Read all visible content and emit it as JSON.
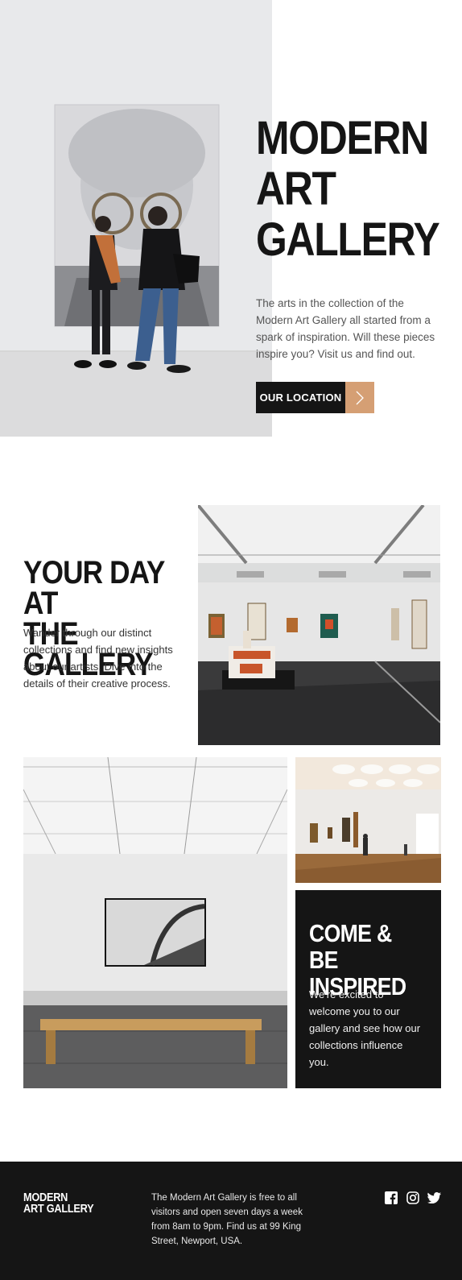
{
  "hero": {
    "title_line1": "MODERN",
    "title_line2": "ART",
    "title_line3": "GALLERY",
    "description": "The arts in the collection of the Modern Art Gallery all started from a spark of inspiration. Will these pieces inspire you? Visit us and find out.",
    "button_label": "OUR LOCATION",
    "button_icon": "chevron-right-icon",
    "accent_color": "#d59f74"
  },
  "day_section": {
    "title_line1": "YOUR DAY AT",
    "title_line2": "THE GALLERY",
    "description": "Wander through our distinct collections and find new insights about our artists. Dive into the details of their creative process."
  },
  "inspired_section": {
    "title_line1": "COME & BE",
    "title_line2": "INSPIRED",
    "description": "We're excited to welcome you to our gallery and see how our collections influence you."
  },
  "footer": {
    "logo_line1": "MODERN",
    "logo_line2": "ART GALLERY",
    "description": "The Modern Art Gallery is free to all visitors and open seven days a week from 8am to 9pm. Find us at 99 King Street, Newport, USA.",
    "social_icons": [
      "facebook-icon",
      "instagram-icon",
      "twitter-icon"
    ]
  },
  "colors": {
    "dark": "#151515",
    "accent": "#d59f74",
    "white": "#ffffff"
  }
}
